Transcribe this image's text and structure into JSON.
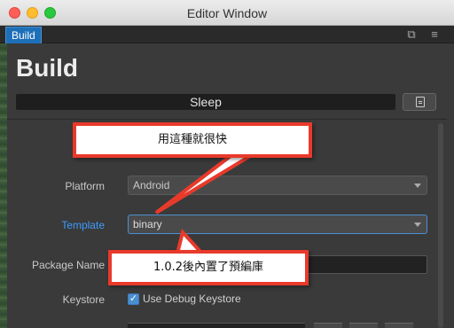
{
  "window": {
    "title": "Editor Window"
  },
  "tab": {
    "label": "Build"
  },
  "panel": {
    "heading": "Build",
    "status_text": "Sleep"
  },
  "fields": {
    "platform": {
      "label": "Platform",
      "value": "Android"
    },
    "template": {
      "label": "Template",
      "value": "binary"
    },
    "package_name": {
      "label": "Package Name",
      "value": ""
    },
    "keystore": {
      "label": "Keystore",
      "checkbox_label": "Use Debug Keystore",
      "checked": true
    }
  },
  "annotations": {
    "callout_top": "用這種就很快",
    "callout_bottom": "1.0.2後內置了預編庫"
  },
  "colors": {
    "accent": "#1d6fb8",
    "label_active": "#3d9bff",
    "annotation_border": "#e83a2b"
  }
}
